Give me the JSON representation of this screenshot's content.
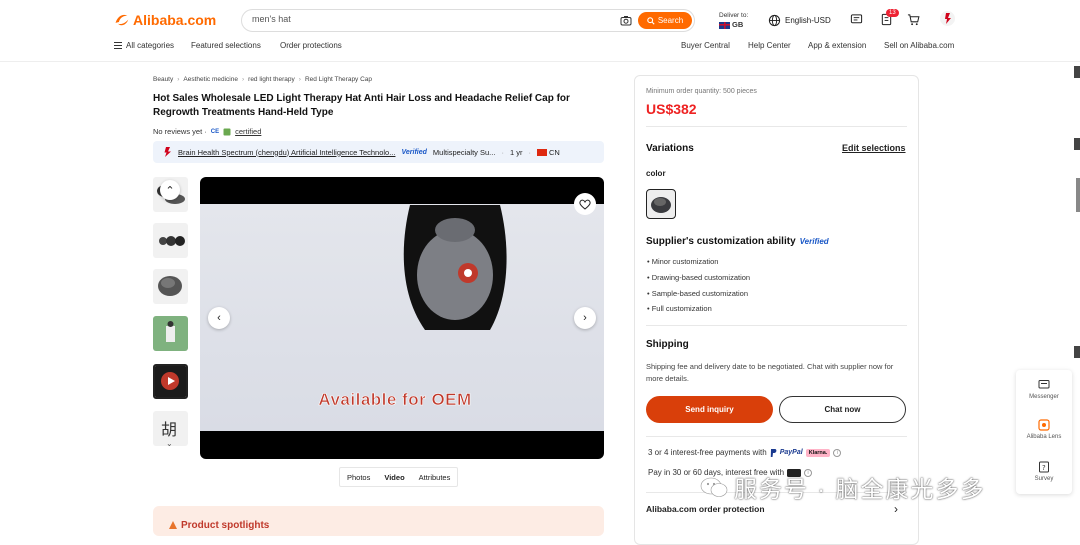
{
  "header": {
    "logo_text": "Alibaba.com",
    "search_value": "men's hat",
    "search_button": "Search",
    "deliver_to_label": "Deliver to:",
    "deliver_country": "GB",
    "language_currency": "English-USD",
    "orders_badge": "13"
  },
  "nav": {
    "all_categories": "All categories",
    "featured_selections": "Featured selections",
    "order_protections": "Order protections",
    "buyer_central": "Buyer Central",
    "help_center": "Help Center",
    "app_extension": "App & extension",
    "sell_on": "Sell on Alibaba.com"
  },
  "breadcrumb": [
    "Beauty",
    "Aesthetic medicine",
    "red light therapy",
    "Red Light Therapy Cap"
  ],
  "product": {
    "title": "Hot Sales Wholesale LED Light Therapy Hat Anti Hair Loss and Headache Relief Cap for Regrowth Treatments Hand-Held Type",
    "no_reviews": "No reviews yet ·",
    "ce_mark": "CE",
    "certified": "certified"
  },
  "supplier": {
    "name": "Brain Health Spectrum (chengdu) Artificial Intelligence Technolo...",
    "verified": "Verified",
    "type": "Multispecialty Su...",
    "years": "1 yr",
    "country": "CN"
  },
  "media": {
    "overlay_text": "Available for OEM",
    "tabs": [
      "Photos",
      "Video",
      "Attributes"
    ],
    "active_tab": "Video"
  },
  "spotlight": {
    "title": "Product spotlights"
  },
  "panel": {
    "moq": "Minimum order quantity: 500 pieces",
    "price": "US$382",
    "variations_title": "Variations",
    "edit_selections": "Edit selections",
    "color_label": "color",
    "customization_title": "Supplier's customization ability",
    "verified": "Verified",
    "customization_items": [
      "Minor customization",
      "Drawing-based customization",
      "Sample-based customization",
      "Full customization"
    ],
    "shipping_title": "Shipping",
    "shipping_text": "Shipping fee and delivery date to be negotiated. Chat with supplier now for more details.",
    "send_inquiry": "Send inquiry",
    "chat_now": "Chat now",
    "payments_text": "3 or 4 interest-free payments with",
    "paypal": "PayPal",
    "klarna": "Klarna.",
    "pay_later_text": "Pay in 30 or 60 days, interest free with",
    "protection": "Alibaba.com order protection"
  },
  "float_bar": {
    "messenger": "Messenger",
    "lens": "Alibaba Lens",
    "survey": "Survey"
  },
  "watermark": {
    "text": "服务号 · 脑全康光多多"
  },
  "colors": {
    "brand": "#ff6a00",
    "price": "#e22222",
    "inquiry": "#d93f0a",
    "verified": "#1a58c7"
  }
}
